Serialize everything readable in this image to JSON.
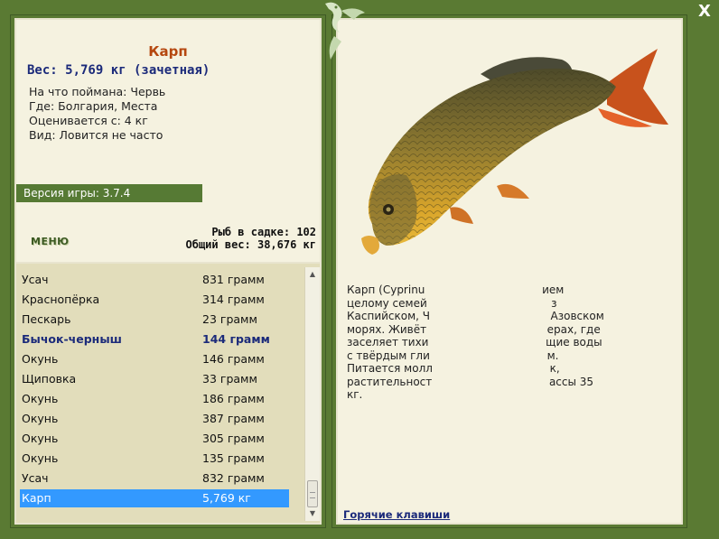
{
  "fish": {
    "title": "Карп",
    "weight": "Вес: 5,769 кг (зачетная)",
    "info": [
      "На что поймана: Червь",
      "Где: Болгария, Места",
      "Оценивается с: 4 кг",
      "Вид: Ловится не часто"
    ]
  },
  "version": "Версия игры: 3.7.4",
  "menu_label": "МЕНЮ",
  "stats": {
    "count": "Рыб в садке: 102",
    "total": "Общий вес: 38,676 кг"
  },
  "catch_list": [
    {
      "name": "Усач",
      "weight": "831 грамм"
    },
    {
      "name": "Краснопёрка",
      "weight": "314 грамм"
    },
    {
      "name": "Пескарь",
      "weight": "23 грамм"
    },
    {
      "name": "Бычок-черныш",
      "weight": "144 грамм"
    },
    {
      "name": "Окунь",
      "weight": "146 грамм"
    },
    {
      "name": "Щиповка",
      "weight": "33 грамм"
    },
    {
      "name": "Окунь",
      "weight": "186 грамм"
    },
    {
      "name": "Окунь",
      "weight": "387 грамм"
    },
    {
      "name": "Окунь",
      "weight": "305 грамм"
    },
    {
      "name": "Окунь",
      "weight": "135 грамм"
    },
    {
      "name": "Усач",
      "weight": "832 грамм"
    },
    {
      "name": "Карп",
      "weight": "5,769 кг"
    }
  ],
  "description": {
    "lines": [
      "Карп (Cyprinu                                  ием",
      "целому семей                                    з",
      "Каспийском, Ч                                   Азовском",
      "морях. Живёт                                   ерах, где",
      "заселяет тихи                                  щие воды",
      "с твёрдым гли                                  м.",
      "Питается молл                                  к,",
      "растительност                                  ассы 35",
      "кг."
    ]
  },
  "hotkeys_label": "Горячие клавиши",
  "close_label": "X",
  "colors": {
    "frame": "#587b36",
    "panel": "#f5f2e0",
    "list_bg": "#e2ddbb",
    "title": "#b5470f",
    "accent_text": "#1b2a7a",
    "selection": "#3399ff"
  },
  "icons": [
    "close-icon",
    "game-logo-icon",
    "carp-fish-image",
    "scroll-up-icon",
    "scroll-down-icon"
  ]
}
